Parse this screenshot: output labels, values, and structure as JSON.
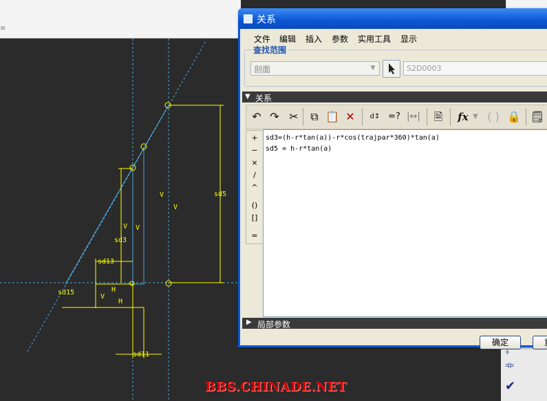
{
  "dialog": {
    "title": "关系",
    "menu": [
      "文件",
      "编辑",
      "插入",
      "参数",
      "实用工具",
      "显示"
    ],
    "find_range": {
      "label": "查找范围",
      "type_value": "剖面",
      "object_value": "S2D0003"
    },
    "relations_header": "关系",
    "toolbar_icons": [
      "undo-icon",
      "redo-icon",
      "cut-icon",
      "copy-icon",
      "paste-icon",
      "delete-icon",
      "value-toggle-icon",
      "evaluate-icon",
      "units-icon",
      "sort-relations-icon",
      "function-icon",
      "parentheses-icon",
      "lock-param-icon",
      "verify-icon"
    ],
    "toolbar_labels": {
      "evaluate": "=?",
      "function": "fx"
    },
    "operators": [
      "+",
      "−",
      "×",
      "/",
      "^",
      "()",
      "[]",
      "="
    ],
    "relations": [
      "sd3=(h-r*tan(a))-r*cos(trajpar*360)*tan(a)",
      "sd5 = h-r*tan(a)"
    ],
    "local_params_header": "局部参数",
    "ok_label": "确定",
    "reset_label": "重"
  },
  "sketch": {
    "dimension_labels": [
      "sd5",
      "sd3",
      "sd13",
      "sd15",
      "sd11",
      "V",
      "V",
      "V",
      "V",
      "V",
      "V",
      "H",
      "H"
    ]
  },
  "watermark": "BBS.CHINADE.NET",
  "colors": {
    "titlebar": "#0b55d2",
    "dialog_bg": "#ece9d8",
    "canvas_bg": "#2b2b2b",
    "dimension": "#ffff00",
    "construction": "#4aa8e0",
    "watermark": "#d10000"
  }
}
